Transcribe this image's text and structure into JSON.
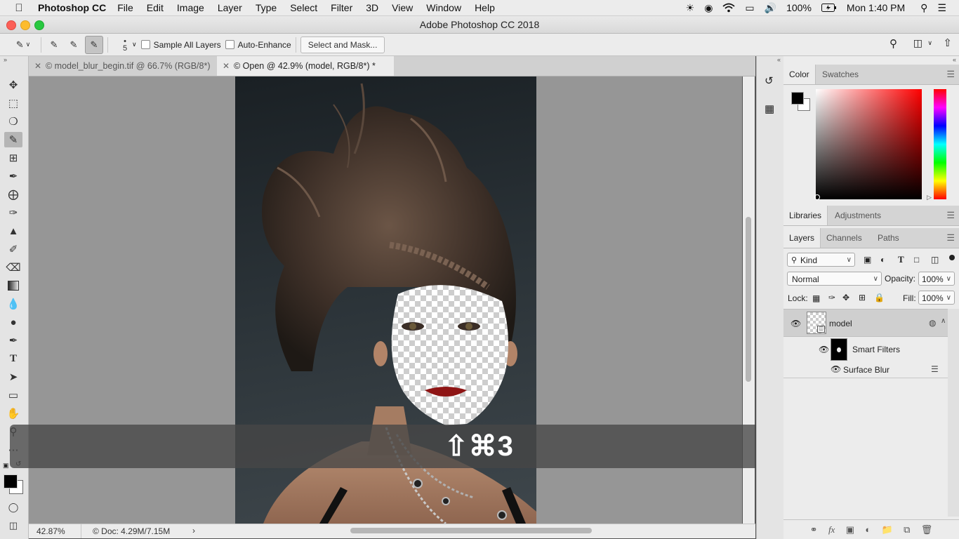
{
  "menubar": {
    "app_name": "Photoshop CC",
    "items": [
      "File",
      "Edit",
      "Image",
      "Layer",
      "Type",
      "Select",
      "Filter",
      "3D",
      "View",
      "Window",
      "Help"
    ],
    "battery": "100%",
    "clock": "Mon 1:40 PM"
  },
  "window": {
    "title": "Adobe Photoshop CC 2018"
  },
  "options": {
    "brush_size": "5",
    "sample_all_layers": "Sample All Layers",
    "auto_enhance": "Auto-Enhance",
    "select_and_mask": "Select and Mask..."
  },
  "tabs": [
    {
      "label": "© model_blur_begin.tif @ 66.7% (RGB/8*)"
    },
    {
      "label": "© Open @ 42.9% (model, RGB/8*) *"
    }
  ],
  "status": {
    "zoom": "42.87%",
    "doc": "© Doc: 4.29M/7.15M"
  },
  "overlay": {
    "shortcut": "⇧⌘3"
  },
  "color_panel": {
    "tabs": [
      "Color",
      "Swatches"
    ],
    "foreground": "#000000",
    "background": "#ffffff"
  },
  "libraries_panel": {
    "tabs": [
      "Libraries",
      "Adjustments"
    ]
  },
  "layers_panel": {
    "tabs": [
      "Layers",
      "Channels",
      "Paths"
    ],
    "filter_kind": "Kind",
    "blend_mode": "Normal",
    "opacity_label": "Opacity:",
    "opacity_value": "100%",
    "lock_label": "Lock:",
    "fill_label": "Fill:",
    "fill_value": "100%",
    "layers": [
      {
        "name": "model"
      },
      {
        "name": "Smart Filters"
      },
      {
        "name": "Surface Blur"
      }
    ]
  }
}
